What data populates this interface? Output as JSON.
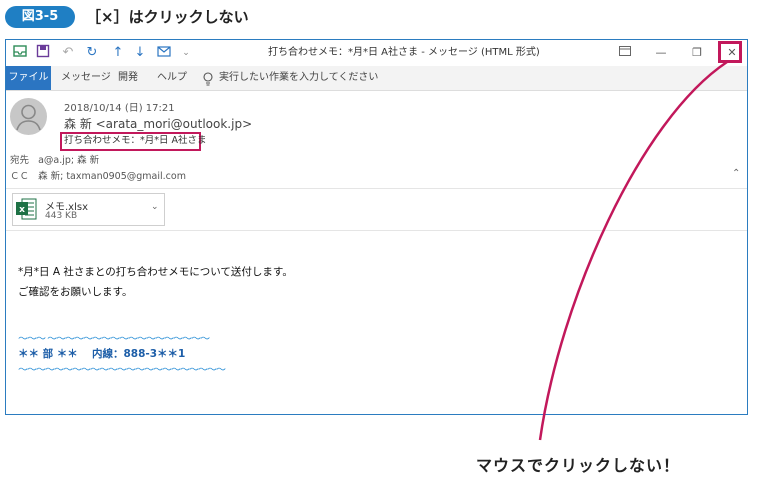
{
  "figure": {
    "badge": "図3-5",
    "title": "［×］はクリックしない"
  },
  "window": {
    "title": "打ち合わせメモ：*月*日 A社さま - メッセージ (HTML 形式)",
    "controls": {
      "restore_icon": "restore-icon",
      "minimize": "—",
      "maximize": "❐",
      "close": "✕"
    }
  },
  "menu": {
    "file": "ファイル",
    "items": [
      "メッセージ",
      "開発",
      "ヘルプ"
    ],
    "tell_me": "実行したい作業を入力してください"
  },
  "message": {
    "date": "2018/10/14 (日) 17:21",
    "from": "森 新 <arata_mori@outlook.jp>",
    "subject": "打ち合わせメモ：*月*日 A社さま",
    "to_label": "宛先",
    "to_value": "a@a.jp; 森 新",
    "cc_label": "ＣＣ",
    "cc_value": "森 新; taxman0905@gmail.com"
  },
  "attachment": {
    "name": "メモ.xlsx",
    "size": "443 KB"
  },
  "body": {
    "line1": "*月*日 A 社さまとの打ち合わせメモについて送付します。",
    "line2": "ご確認をお願いします。",
    "sig_top": "～～～ ～～～～～～～～～～～～～～～～～～",
    "sig_mid": "＊＊ 部 ＊＊　 内線：888-3＊＊1",
    "sig_bottom": "～～～～～～～～～～～～～～～～～～～～～～～"
  },
  "annotation": "マウスでクリックしない！",
  "colors": {
    "accent": "#2b75c2",
    "badge": "#1f7fc4",
    "highlight": "#c2185b",
    "excel": "#1e7145"
  }
}
